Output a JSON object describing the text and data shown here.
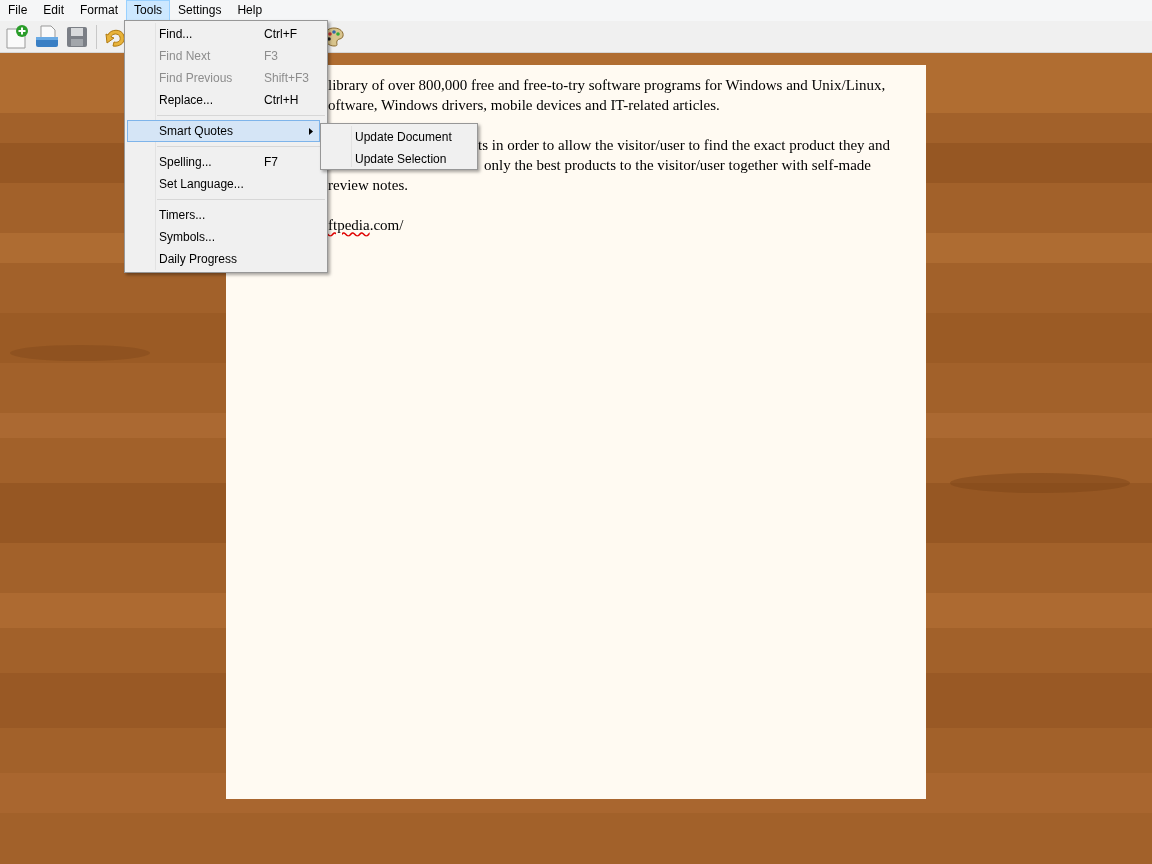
{
  "menu_bar": [
    {
      "label": "File",
      "selected": false
    },
    {
      "label": "Edit",
      "selected": false
    },
    {
      "label": "Format",
      "selected": false
    },
    {
      "label": "Tools",
      "selected": true
    },
    {
      "label": "Settings",
      "selected": false
    },
    {
      "label": "Help",
      "selected": false
    }
  ],
  "open_menu": {
    "items": [
      {
        "kind": "item",
        "label": "Find...",
        "shortcut": "Ctrl+F",
        "disabled": false
      },
      {
        "kind": "item",
        "label": "Find Next",
        "shortcut": "F3",
        "disabled": true
      },
      {
        "kind": "item",
        "label": "Find Previous",
        "shortcut": "Shift+F3",
        "disabled": true
      },
      {
        "kind": "item",
        "label": "Replace...",
        "shortcut": "Ctrl+H",
        "disabled": false
      },
      {
        "kind": "separator"
      },
      {
        "kind": "submenu",
        "label": "Smart Quotes",
        "selected": true
      },
      {
        "kind": "separator"
      },
      {
        "kind": "item",
        "label": "Spelling...",
        "shortcut": "F7",
        "disabled": false
      },
      {
        "kind": "item",
        "label": "Set Language...",
        "disabled": false
      },
      {
        "kind": "separator"
      },
      {
        "kind": "item",
        "label": "Timers...",
        "disabled": false
      },
      {
        "kind": "item",
        "label": "Symbols...",
        "disabled": false
      },
      {
        "kind": "item",
        "label": "Daily Progress",
        "disabled": false
      }
    ]
  },
  "submenu": {
    "items": [
      {
        "label": "Update Document"
      },
      {
        "label": "Update Selection"
      }
    ]
  },
  "document": {
    "paragraphs": [
      {
        "lines": [
          [
            {
              "text": "library of over 800,000 free and free-to-try software programs for Windows and Unix/Linux,",
              "misspelled": false
            }
          ],
          [
            {
              "text": "oftware, Windows drivers, mobile devices and IT-related articles.",
              "misspelled": false
            }
          ]
        ]
      },
      {
        "lines": [
          [
            {
              "text": "ts in order to allow the visitor/user to find the exact product they and",
              "misspelled": false
            }
          ],
          [
            {
              "text": "only the best products to the visitor/user together with self-made",
              "misspelled": false
            }
          ],
          [
            {
              "text": "review notes.",
              "misspelled": false
            }
          ]
        ]
      },
      {
        "lines": [
          [
            {
              "text": "ftpedia",
              "misspelled": true
            },
            {
              "text": ".com/",
              "misspelled": false
            }
          ]
        ]
      }
    ]
  }
}
